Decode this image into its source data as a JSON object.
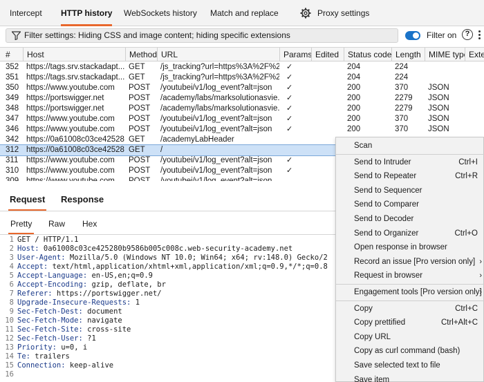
{
  "top_tabs": [
    {
      "label": "Intercept"
    },
    {
      "label": "HTTP history"
    },
    {
      "label": "WebSockets history"
    },
    {
      "label": "Match and replace"
    },
    {
      "label": "Proxy settings"
    }
  ],
  "filter": {
    "text": "Filter settings: Hiding CSS and image content; hiding specific extensions",
    "toggle_label": "Filter on",
    "help": "?"
  },
  "table": {
    "columns": [
      "#",
      "Host",
      "Method",
      "URL",
      "Params",
      "Edited",
      "Status code",
      "Length",
      "MIME type",
      "Exten"
    ],
    "rows": [
      {
        "num": "352",
        "host": "https://tags.srv.stackadapt....",
        "method": "GET",
        "url": "/js_tracking?url=https%3A%2F%2...",
        "params": "✓",
        "status": "204",
        "length": "224",
        "mime": ""
      },
      {
        "num": "351",
        "host": "https://tags.srv.stackadapt....",
        "method": "GET",
        "url": "/js_tracking?url=https%3A%2F%2...",
        "params": "✓",
        "status": "204",
        "length": "224",
        "mime": ""
      },
      {
        "num": "350",
        "host": "https://www.youtube.com",
        "method": "POST",
        "url": "/youtubei/v1/log_event?alt=json",
        "params": "✓",
        "status": "200",
        "length": "370",
        "mime": "JSON"
      },
      {
        "num": "349",
        "host": "https://portswigger.net",
        "method": "POST",
        "url": "/academy/labs/marksolutionasvie...",
        "params": "✓",
        "status": "200",
        "length": "2279",
        "mime": "JSON"
      },
      {
        "num": "348",
        "host": "https://portswigger.net",
        "method": "POST",
        "url": "/academy/labs/marksolutionasvie...",
        "params": "✓",
        "status": "200",
        "length": "2279",
        "mime": "JSON"
      },
      {
        "num": "347",
        "host": "https://www.youtube.com",
        "method": "POST",
        "url": "/youtubei/v1/log_event?alt=json",
        "params": "✓",
        "status": "200",
        "length": "370",
        "mime": "JSON"
      },
      {
        "num": "346",
        "host": "https://www.youtube.com",
        "method": "POST",
        "url": "/youtubei/v1/log_event?alt=json",
        "params": "✓",
        "status": "200",
        "length": "370",
        "mime": "JSON"
      },
      {
        "num": "342",
        "host": "https://0a61008c03ce42528...",
        "method": "GET",
        "url": "/academyLabHeader",
        "params": "",
        "status": "",
        "length": "",
        "mime": ""
      },
      {
        "num": "312",
        "host": "https://0a61008c03ce42528...",
        "method": "GET",
        "url": "/",
        "params": "",
        "status": "",
        "length": "",
        "mime": ""
      },
      {
        "num": "311",
        "host": "https://www.youtube.com",
        "method": "POST",
        "url": "/youtubei/v1/log_event?alt=json",
        "params": "✓",
        "status": "",
        "length": "",
        "mime": ""
      },
      {
        "num": "310",
        "host": "https://www.youtube.com",
        "method": "POST",
        "url": "/youtubei/v1/log_event?alt=json",
        "params": "✓",
        "status": "",
        "length": "",
        "mime": ""
      },
      {
        "num": "309",
        "host": "https://www.youtube.com",
        "method": "POST",
        "url": "/youtubei/v1/log_event?alt=json",
        "params": "",
        "status": "",
        "length": "",
        "mime": ""
      }
    ]
  },
  "message_tabs": [
    {
      "label": "Request"
    },
    {
      "label": "Response"
    }
  ],
  "view_tabs": [
    {
      "label": "Pretty"
    },
    {
      "label": "Raw"
    },
    {
      "label": "Hex"
    }
  ],
  "request_lines": [
    {
      "n": "1",
      "key": "",
      "val": "GET / HTTP/1.1"
    },
    {
      "n": "2",
      "key": "Host:",
      "val": " 0a61008c03ce425280b9586b005c008c.web-security-academy.net"
    },
    {
      "n": "3",
      "key": "User-Agent:",
      "val": " Mozilla/5.0 (Windows NT 10.0; Win64; x64; rv:148.0) Gecko/2"
    },
    {
      "n": "4",
      "key": "Accept:",
      "val": " text/html,application/xhtml+xml,application/xml;q=0.9,*/*;q=0.8"
    },
    {
      "n": "5",
      "key": "Accept-Language:",
      "val": " en-US,en;q=0.9"
    },
    {
      "n": "6",
      "key": "Accept-Encoding:",
      "val": " gzip, deflate, br"
    },
    {
      "n": "7",
      "key": "Referer:",
      "val": " https://portswigger.net/"
    },
    {
      "n": "8",
      "key": "Upgrade-Insecure-Requests:",
      "val": " 1"
    },
    {
      "n": "9",
      "key": "Sec-Fetch-Dest:",
      "val": " document"
    },
    {
      "n": "10",
      "key": "Sec-Fetch-Mode:",
      "val": " navigate"
    },
    {
      "n": "11",
      "key": "Sec-Fetch-Site:",
      "val": " cross-site"
    },
    {
      "n": "12",
      "key": "Sec-Fetch-User:",
      "val": " ?1"
    },
    {
      "n": "13",
      "key": "Priority:",
      "val": " u=0, i"
    },
    {
      "n": "14",
      "key": "Te:",
      "val": " trailers"
    },
    {
      "n": "15",
      "key": "Connection:",
      "val": " keep-alive"
    },
    {
      "n": "16",
      "key": "",
      "val": ""
    }
  ],
  "context_menu": [
    {
      "label": "Scan",
      "shortcut": "",
      "submenu": false
    },
    {
      "sep": true
    },
    {
      "label": "Send to Intruder",
      "shortcut": "Ctrl+I",
      "submenu": false
    },
    {
      "label": "Send to Repeater",
      "shortcut": "Ctrl+R",
      "submenu": false
    },
    {
      "label": "Send to Sequencer",
      "shortcut": "",
      "submenu": false
    },
    {
      "label": "Send to Comparer",
      "shortcut": "",
      "submenu": false
    },
    {
      "label": "Send to Decoder",
      "shortcut": "",
      "submenu": false
    },
    {
      "label": "Send to Organizer",
      "shortcut": "Ctrl+O",
      "submenu": false
    },
    {
      "label": "Open response in browser",
      "shortcut": "",
      "submenu": false
    },
    {
      "label": "Record an issue [Pro version only]",
      "shortcut": "",
      "submenu": true
    },
    {
      "label": "Request in browser",
      "shortcut": "",
      "submenu": true
    },
    {
      "sep": true
    },
    {
      "label": "Engagement tools [Pro version only]",
      "shortcut": "",
      "submenu": true
    },
    {
      "sep": true
    },
    {
      "label": "Copy",
      "shortcut": "Ctrl+C",
      "submenu": false
    },
    {
      "label": "Copy prettified",
      "shortcut": "Ctrl+Alt+C",
      "submenu": false
    },
    {
      "label": "Copy URL",
      "shortcut": "",
      "submenu": false
    },
    {
      "label": "Copy as curl command (bash)",
      "shortcut": "",
      "submenu": false
    },
    {
      "label": "Save selected text to file",
      "shortcut": "",
      "submenu": false
    },
    {
      "label": "Save item",
      "shortcut": "",
      "submenu": false
    }
  ],
  "selected_row_num": "312",
  "colors": {
    "accent": "#e8672c",
    "toggle": "#1a73c8",
    "selection": "#cde1f7"
  }
}
